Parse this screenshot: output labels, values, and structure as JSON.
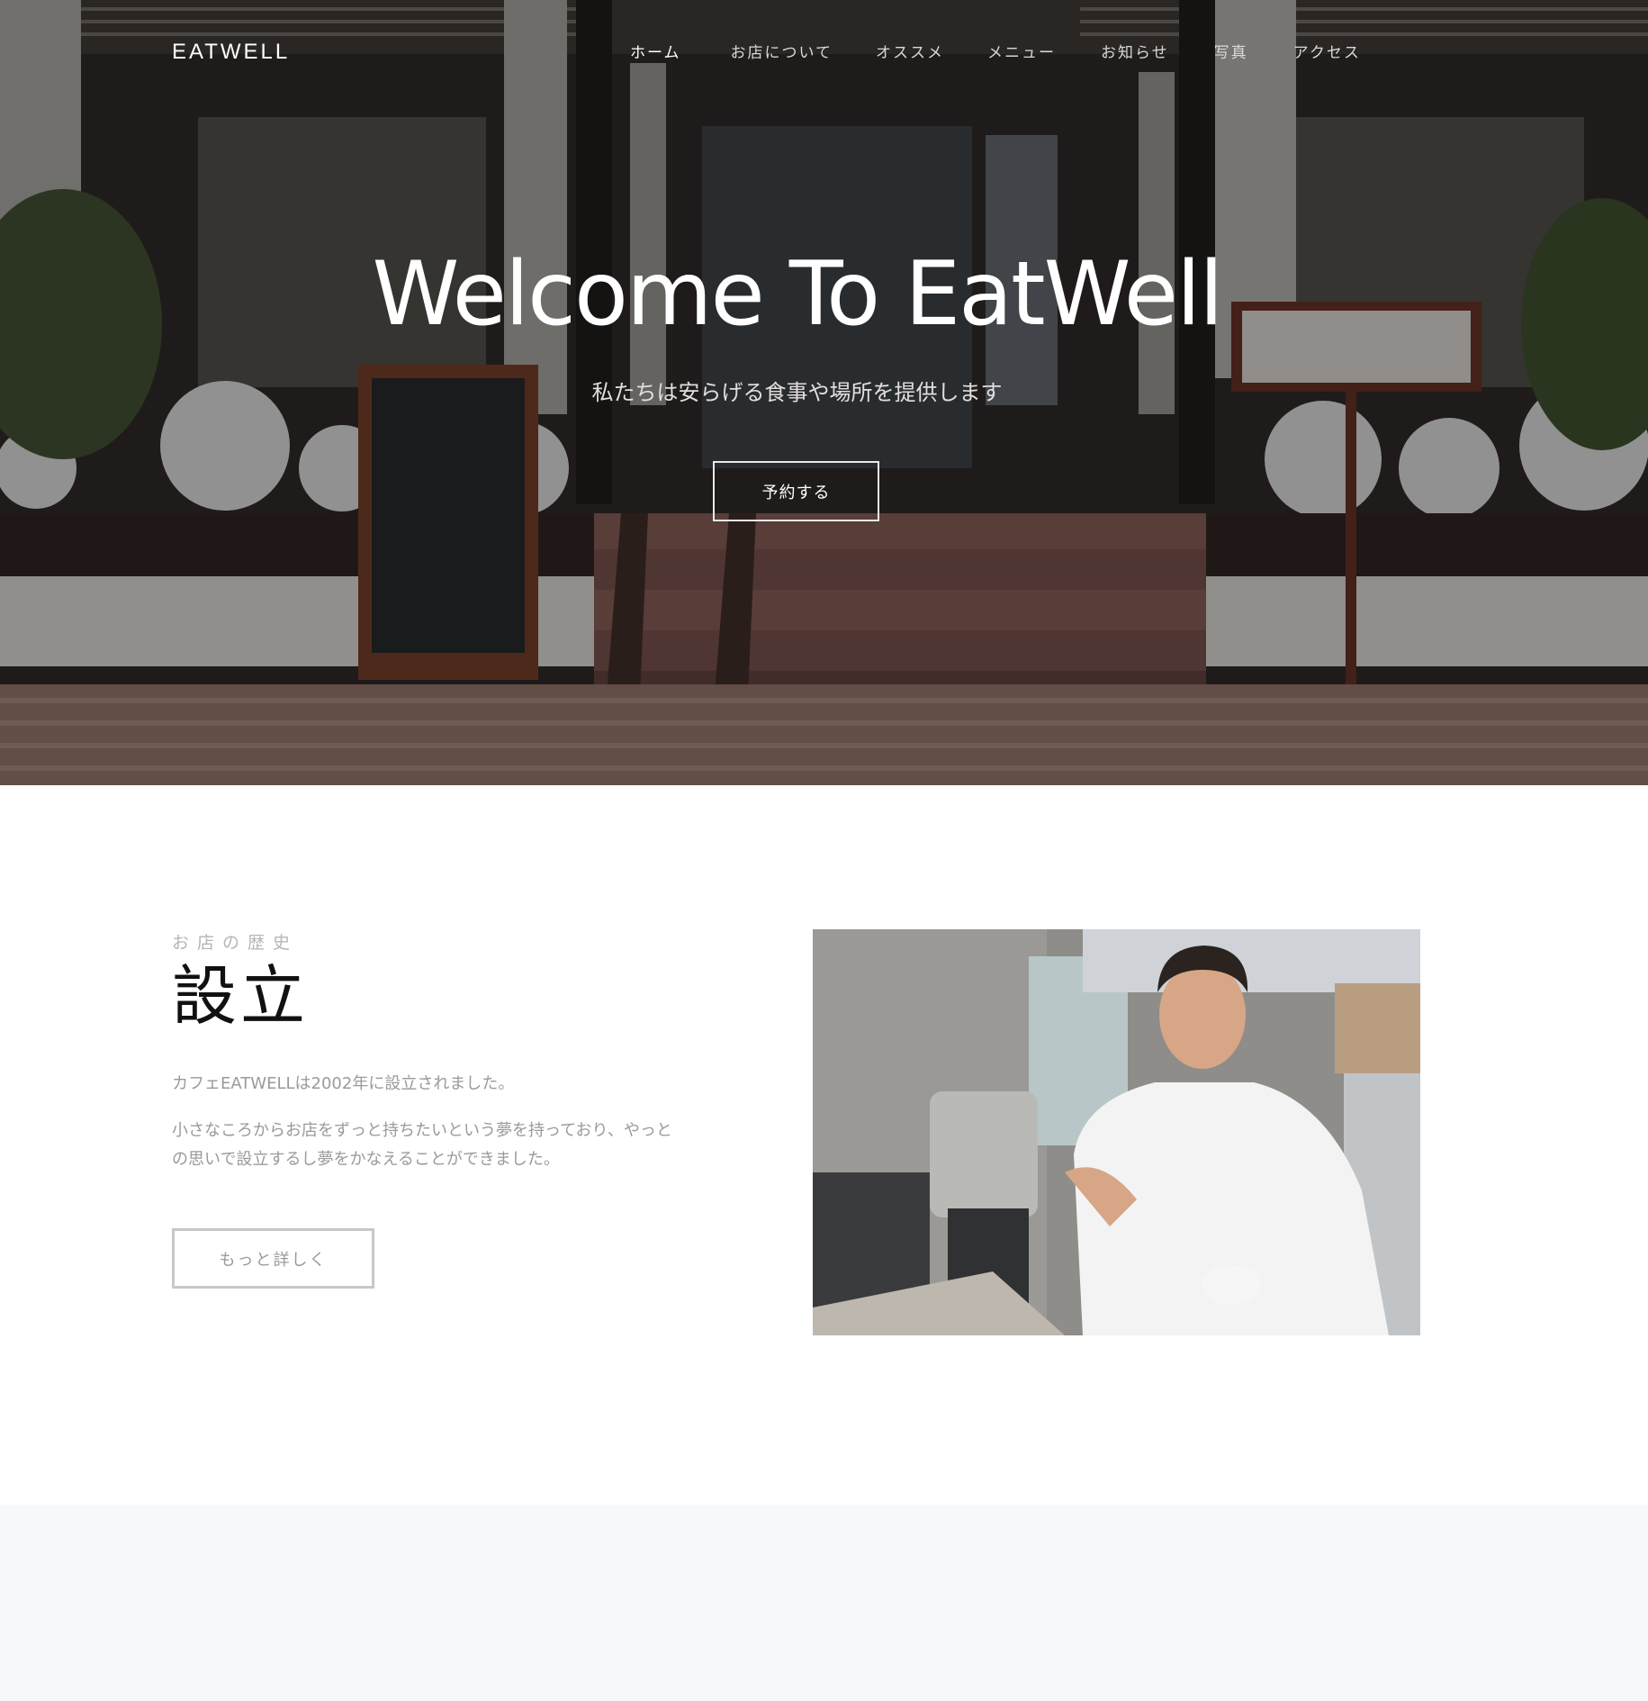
{
  "brand": {
    "logo": "EATWELL"
  },
  "nav": {
    "items": [
      {
        "label": "ホーム",
        "active": true
      },
      {
        "label": "お店について"
      },
      {
        "label": "オススメ"
      },
      {
        "label": "メニュー"
      },
      {
        "label": "お知らせ"
      },
      {
        "label": "写真"
      },
      {
        "label": "アクセス"
      }
    ]
  },
  "hero": {
    "title": "Welcome To EatWell",
    "subtitle": "私たちは安らげる食事や場所を提供します",
    "cta": "予約する"
  },
  "about": {
    "kicker": "お店の歴史",
    "title": "設立",
    "p1": "カフェEATWELLは2002年に設立されました。",
    "p2": "小さなころからお店をずっと持ちたいという夢を持っており、やっとの思いで設立するし夢をかなえることができました。",
    "cta": "もっと詳しく"
  },
  "colors": {
    "accent": "#ffffff",
    "muted_text": "#9a9a9a",
    "light_bg": "#f7f8fa"
  }
}
